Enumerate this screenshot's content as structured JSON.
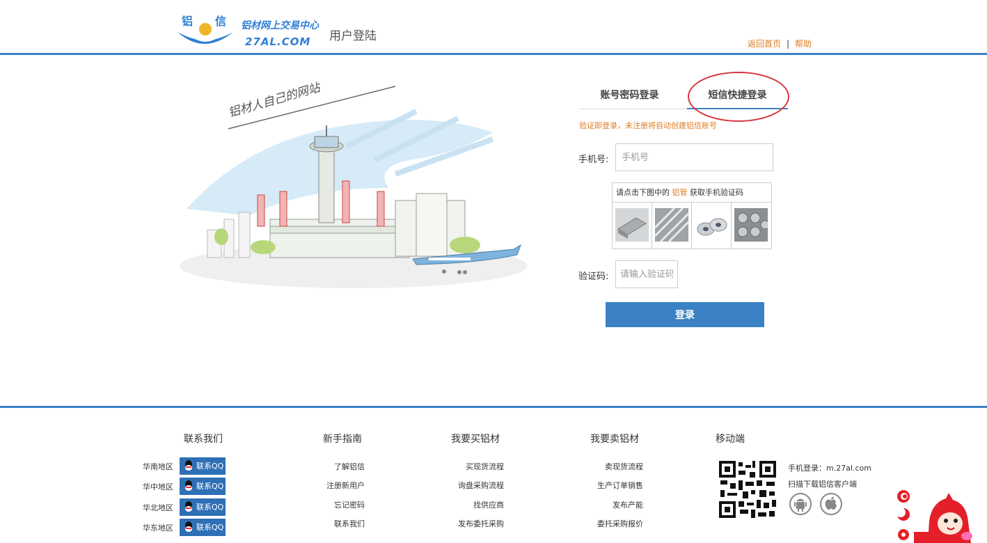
{
  "header": {
    "logo_chars": [
      "铝",
      "信"
    ],
    "logo_cn": "铝材网上交易中心",
    "logo_en": "27AL.COM",
    "page_title": "用户登陆",
    "home_link": "返回首页",
    "separator": "|",
    "help_link": "帮助"
  },
  "illustration": {
    "caption": "铝材人自己的网站"
  },
  "login": {
    "tabs": [
      {
        "label": "账号密码登录",
        "active": false
      },
      {
        "label": "短信快捷登录",
        "active": true
      }
    ],
    "notice": "验证即登录，未注册将自动创建铝信账号",
    "phone_label": "手机号:",
    "phone_placeholder": "手机号",
    "captcha_hint_pre": "请点击下图中的",
    "captcha_hint_keyword": "铝管",
    "captcha_hint_post": "获取手机验证码",
    "captcha_images": [
      "aluminum-profile-icon",
      "aluminum-tubes-icon",
      "aluminum-coils-icon",
      "aluminum-rolls-icon"
    ],
    "code_label": "验证码:",
    "code_placeholder": "请输入验证码",
    "submit_label": "登录"
  },
  "footer": {
    "contact": {
      "title": "联系我们",
      "regions": [
        {
          "name": "华南地区",
          "button": "联系QQ"
        },
        {
          "name": "华中地区",
          "button": "联系QQ"
        },
        {
          "name": "华北地区",
          "button": "联系QQ"
        },
        {
          "name": "华东地区",
          "button": "联系QQ"
        }
      ]
    },
    "guide": {
      "title": "新手指南",
      "links": [
        "了解铝信",
        "注册新用户",
        "忘记密码",
        "联系我们"
      ]
    },
    "buy": {
      "title": "我要买铝材",
      "links": [
        "买现货流程",
        "询盘采购流程",
        "找供应商",
        "发布委托采购"
      ]
    },
    "sell": {
      "title": "我要卖铝材",
      "links": [
        "卖现货流程",
        "生产订单销售",
        "发布产能",
        "委托采购报价"
      ]
    },
    "mobile": {
      "title": "移动端",
      "login_text": "手机登录：m.27al.com",
      "scan_text": "扫描下载铝信客户端"
    }
  },
  "colors": {
    "accent": "#3b82c4",
    "orange": "#e07b1e",
    "highlight_circle": "#d9343c"
  }
}
